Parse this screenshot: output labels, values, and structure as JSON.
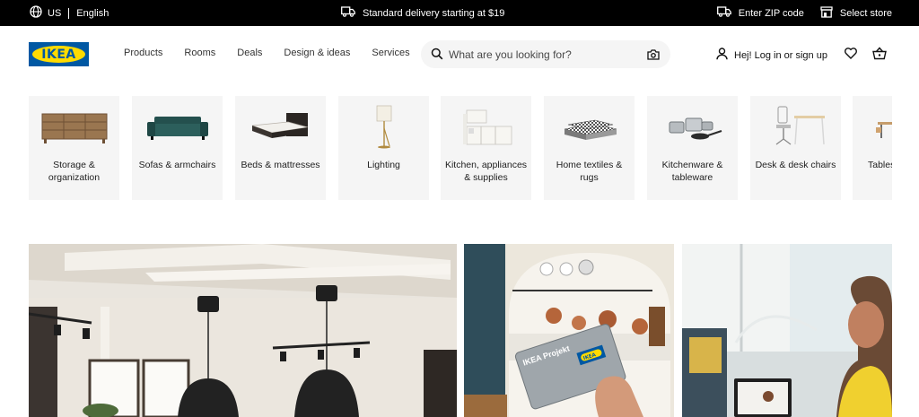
{
  "topbar": {
    "locale_country": "US",
    "locale_language": "English",
    "delivery_text": "Standard delivery starting at $19",
    "zip_label": "Enter ZIP code",
    "store_label": "Select store"
  },
  "header": {
    "logo_text": "IKEA",
    "nav": [
      "Products",
      "Rooms",
      "Deals",
      "Design & ideas",
      "Services"
    ],
    "search_placeholder": "What are you looking for?",
    "account_label": "Hej! Log in or sign up"
  },
  "categories": [
    {
      "label": "Storage & organization"
    },
    {
      "label": "Sofas & armchairs"
    },
    {
      "label": "Beds & mattresses"
    },
    {
      "label": "Lighting"
    },
    {
      "label": "Kitchen, appliances & supplies"
    },
    {
      "label": "Home textiles & rugs"
    },
    {
      "label": "Kitchenware & tableware"
    },
    {
      "label": "Desk & desk chairs"
    },
    {
      "label": "Tables"
    }
  ],
  "hero": {
    "card_text": "IKEA Projekt",
    "card_logo": "IKEA"
  },
  "colors": {
    "brand_blue": "#0058a3",
    "brand_yellow": "#ffdb00",
    "topbar_bg": "#000000",
    "tile_bg": "#f5f5f5"
  }
}
